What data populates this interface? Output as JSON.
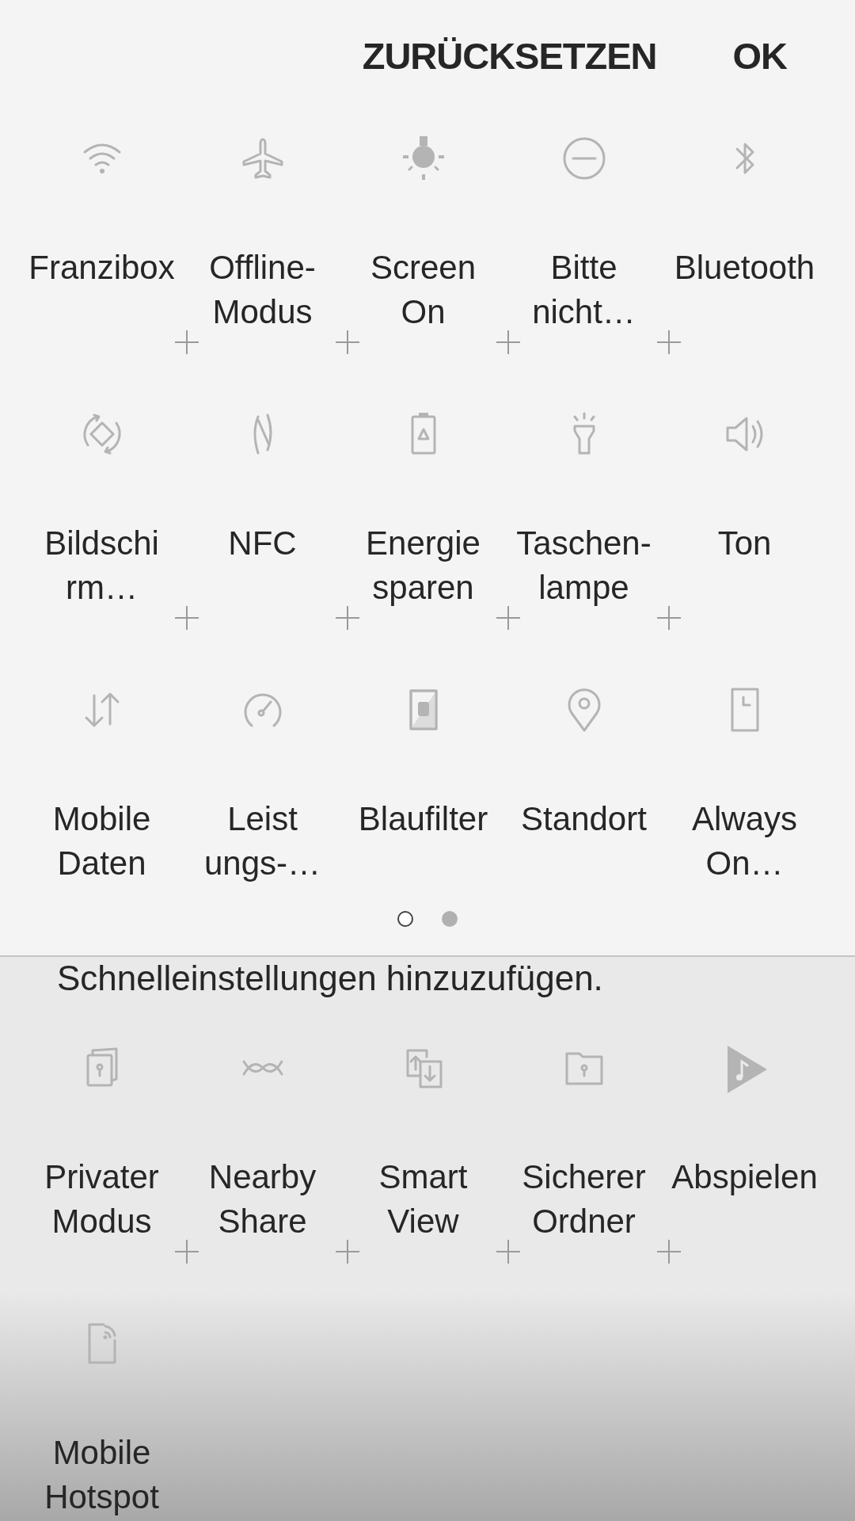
{
  "header": {
    "buttons": [
      {
        "label": "ZURÜCKSETZEN"
      },
      {
        "label": "OK"
      }
    ]
  },
  "active_tiles": [
    {
      "label": "Franzibox",
      "kind": "wifi"
    },
    {
      "label": "Offline-\nModus",
      "kind": "airplane"
    },
    {
      "label": "Screen\nOn",
      "kind": "bulb"
    },
    {
      "label": "Bitte\nnicht…",
      "kind": "dnd"
    },
    {
      "label": "Bluetooth",
      "kind": "bluetooth"
    },
    {
      "label": "Bildschi\nrm…",
      "kind": "rotate"
    },
    {
      "label": "NFC",
      "kind": "nfc"
    },
    {
      "label": "Energie\nsparen",
      "kind": "battery"
    },
    {
      "label": "Taschen-\nlampe",
      "kind": "flashlight"
    },
    {
      "label": "Ton",
      "kind": "sound"
    },
    {
      "label": "Mobile\nDaten",
      "kind": "data"
    },
    {
      "label": "Leist\nungs-…",
      "kind": "gauge"
    },
    {
      "label": "Blaufilter",
      "kind": "filter"
    },
    {
      "label": "Standort",
      "kind": "location"
    },
    {
      "label": "Always\nOn…",
      "kind": "always"
    }
  ],
  "pages": [
    {
      "selected": true
    },
    {
      "selected": false
    }
  ],
  "available": {
    "hint": "Schnelleinstellungen hinzuzufügen.",
    "tiles": [
      {
        "label": "Privater\nModus",
        "kind": "private"
      },
      {
        "label": "Nearby\nShare",
        "kind": "nearby"
      },
      {
        "label": "Smart\nView",
        "kind": "smartview"
      },
      {
        "label": "Sicherer\nOrdner",
        "kind": "folder"
      },
      {
        "label": "Abspielen",
        "kind": "play"
      },
      {
        "label": "Mobile\nHotspot",
        "kind": "hotspot"
      }
    ]
  }
}
